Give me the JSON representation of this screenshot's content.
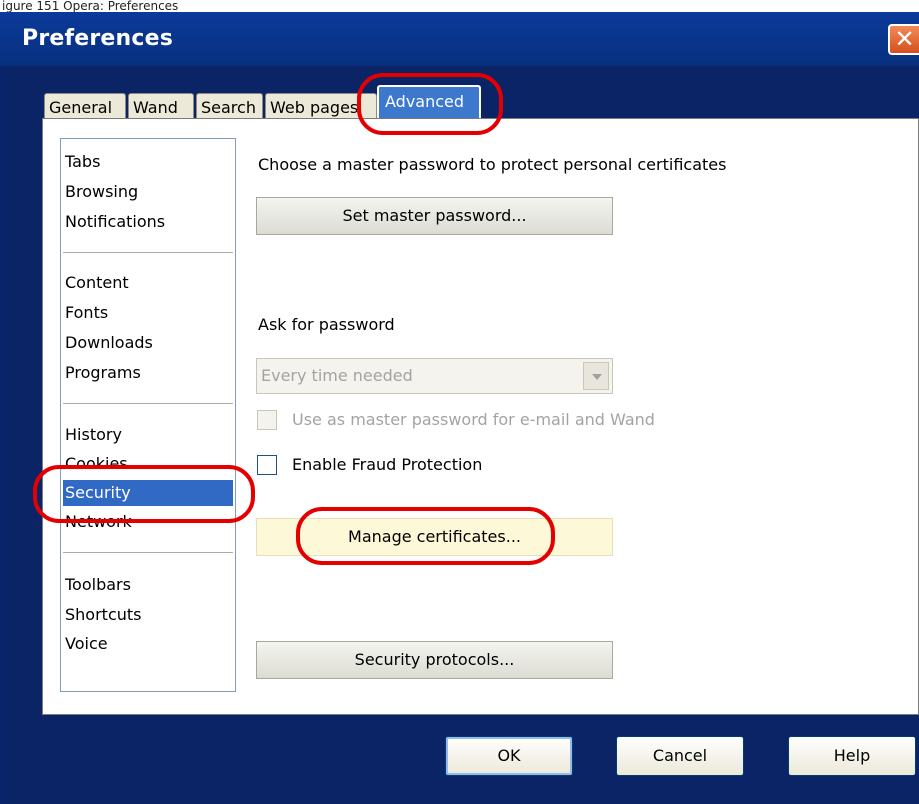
{
  "caption": "igure 151 Opera: Preferences",
  "window": {
    "title": "Preferences",
    "close_glyph": "✕"
  },
  "tabs": [
    {
      "label": "General",
      "active": false
    },
    {
      "label": "Wand",
      "active": false
    },
    {
      "label": "Search",
      "active": false
    },
    {
      "label": "Web pages",
      "active": false
    },
    {
      "label": "Advanced",
      "active": true
    }
  ],
  "sidebar": {
    "groups": [
      [
        "Tabs",
        "Browsing",
        "Notifications"
      ],
      [
        "Content",
        "Fonts",
        "Downloads",
        "Programs"
      ],
      [
        "History",
        "Cookies",
        "Security",
        "Network"
      ],
      [
        "Toolbars",
        "Shortcuts",
        "Voice"
      ]
    ],
    "selected": "Security"
  },
  "content": {
    "master_password_heading": "Choose a master password to protect personal certificates",
    "set_master_password_button": "Set master password...",
    "ask_for_password_label": "Ask for password",
    "ask_for_password_value": "Every time needed",
    "use_master_password_label": "Use as master password for e-mail and Wand",
    "enable_fraud_protection_label": "Enable Fraud Protection",
    "manage_certificates_button": "Manage certificates...",
    "security_protocols_button": "Security protocols..."
  },
  "footer": {
    "ok": "OK",
    "cancel": "Cancel",
    "help": "Help"
  },
  "colors": {
    "titlebar": "#0a3a9a",
    "selected": "#316ac5",
    "annotation_ring": "#e40000"
  }
}
